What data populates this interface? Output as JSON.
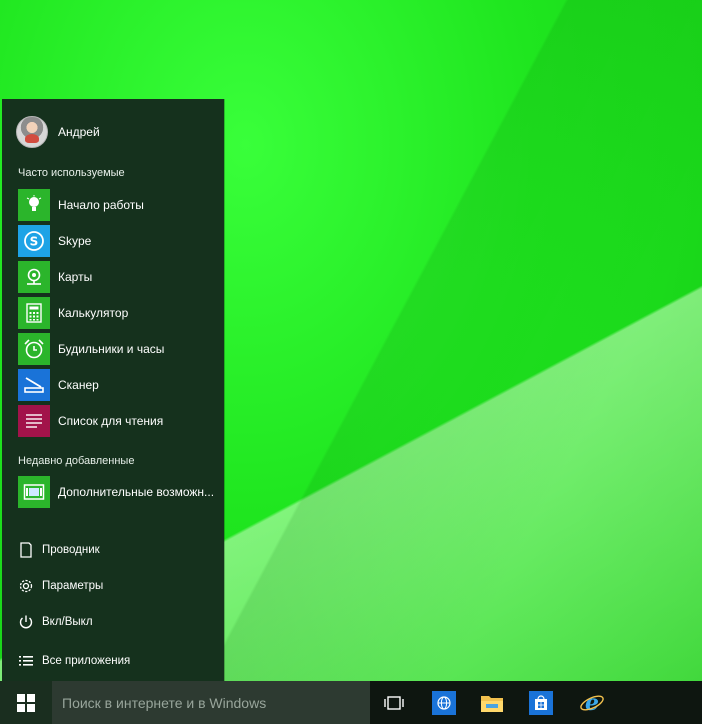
{
  "user": {
    "name": "Андрей"
  },
  "sections": {
    "frequent": "Часто используемые",
    "recent": "Недавно добавленные"
  },
  "frequent_apps": [
    {
      "label": "Начало работы",
      "color": "#2bb52b",
      "icon": "lightbulb-icon"
    },
    {
      "label": "Skype",
      "color": "#1ea3e6",
      "icon": "skype-icon"
    },
    {
      "label": "Карты",
      "color": "#2bb52b",
      "icon": "maps-icon"
    },
    {
      "label": "Калькулятор",
      "color": "#2bb52b",
      "icon": "calculator-icon"
    },
    {
      "label": "Будильники и часы",
      "color": "#2bb52b",
      "icon": "alarm-clock-icon"
    },
    {
      "label": "Сканер",
      "color": "#1a73d8",
      "icon": "scanner-icon"
    },
    {
      "label": "Список для чтения",
      "color": "#a2134a",
      "icon": "reading-list-icon"
    }
  ],
  "recent_apps": [
    {
      "label": "Дополнительные возможн...",
      "color": "#2bb52b",
      "icon": "extras-icon"
    }
  ],
  "system": [
    {
      "label": "Проводник",
      "icon": "explorer-icon"
    },
    {
      "label": "Параметры",
      "icon": "settings-gear-icon"
    },
    {
      "label": "Вкл/Выкл",
      "icon": "power-icon"
    },
    {
      "label": "Все приложения",
      "icon": "all-apps-icon"
    }
  ],
  "taskbar": {
    "search_placeholder": "Поиск в интернете и в Windows",
    "icons": [
      "task-view-icon",
      "network-globe-icon",
      "file-explorer-icon",
      "store-icon",
      "internet-explorer-icon"
    ]
  },
  "colors": {
    "menu_bg": "#15311d",
    "accent": "#2bb52b",
    "taskbar_bg": "#0e1610"
  }
}
